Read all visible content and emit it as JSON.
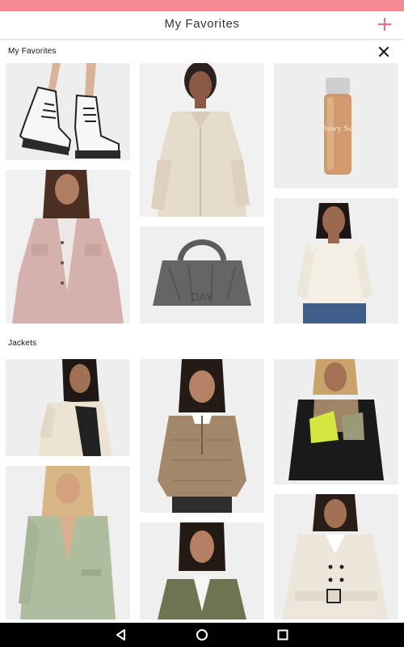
{
  "header": {
    "title": "My Favorites",
    "add_icon": "plus-icon"
  },
  "favorites": {
    "label": "My Favorites",
    "close_icon": "close-icon",
    "items": [
      {
        "name": "white-lace-up-boots"
      },
      {
        "name": "beige-oversized-shirt"
      },
      {
        "name": "dewy-set-spray-bottle"
      },
      {
        "name": "pink-corduroy-jacket"
      },
      {
        "name": "grey-quilted-tote-bag"
      },
      {
        "name": "cream-ribbed-top"
      }
    ]
  },
  "jackets": {
    "label": "Jackets",
    "items": [
      {
        "name": "cream-overshirt-jacket"
      },
      {
        "name": "quilted-brown-pullover"
      },
      {
        "name": "black-neon-fleece-jacket"
      },
      {
        "name": "sage-green-blazer"
      },
      {
        "name": "khaki-utility-jacket"
      },
      {
        "name": "cream-belted-coat"
      }
    ]
  },
  "product_text": {
    "bottle_label": "Dewy Set",
    "bag_print": "DAY"
  },
  "nav": {
    "back_icon": "back-triangle-icon",
    "home_icon": "home-circle-icon",
    "recent_icon": "recent-square-icon"
  },
  "colors": {
    "status_bar": "#f48a94",
    "accent": "#f06f7c",
    "nav_bar": "#000000"
  }
}
